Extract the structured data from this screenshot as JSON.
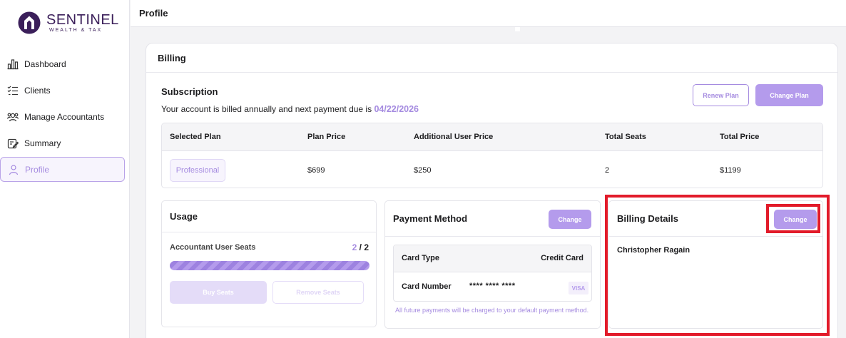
{
  "brand": {
    "name": "SENTINEL",
    "tagline": "WEALTH & TAX"
  },
  "sidebar": {
    "items": [
      {
        "label": "Dashboard",
        "icon": "bar-chart-icon"
      },
      {
        "label": "Clients",
        "icon": "checklist-icon"
      },
      {
        "label": "Manage Accountants",
        "icon": "users-icon"
      },
      {
        "label": "Summary",
        "icon": "edit-icon"
      },
      {
        "label": "Profile",
        "icon": "user-icon",
        "active": true
      }
    ]
  },
  "header": {
    "title": "Profile"
  },
  "billing": {
    "title": "Billing",
    "subscription": {
      "title": "Subscription",
      "text": "Your account is billed annually and next payment due is",
      "due_date": "04/22/2026",
      "renew_label": "Renew Plan",
      "change_label": "Change Plan"
    },
    "plan_table": {
      "headers": [
        "Selected Plan",
        "Plan Price",
        "Additional User Price",
        "Total Seats",
        "Total Price"
      ],
      "row": {
        "plan": "Professional",
        "plan_price": "$699",
        "additional_user_price": "$250",
        "total_seats": "2",
        "total_price": "$1199"
      }
    },
    "usage": {
      "title": "Usage",
      "label": "Accountant User Seats",
      "used": "2",
      "separator": "/",
      "total": "2",
      "progress_percent": 100,
      "buy_label": "Buy Seats",
      "remove_label": "Remove Seats"
    },
    "payment_method": {
      "title": "Payment Method",
      "change_label": "Change",
      "card_type_label": "Card Type",
      "card_type_value": "Credit Card",
      "card_number_label": "Card Number",
      "card_number_value": "**** **** ****",
      "card_brand": "VISA",
      "note": "All future payments will be charged to your default payment method."
    },
    "billing_details": {
      "title": "Billing Details",
      "change_label": "Change",
      "name": "Christopher Ragain"
    }
  },
  "colors": {
    "accent": "#b49bec",
    "accent_text": "#a58be0",
    "highlight": "#e21b2a"
  }
}
